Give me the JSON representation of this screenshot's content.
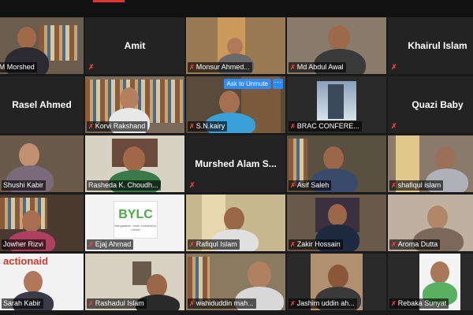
{
  "participants": [
    {
      "name": "AM Morshed",
      "type": "video"
    },
    {
      "name": "Amit",
      "type": "name"
    },
    {
      "name": "Monsur Ahmed...",
      "type": "video"
    },
    {
      "name": "Md Abdul Awal",
      "type": "video"
    },
    {
      "name": "Khairul Islam",
      "type": "name"
    },
    {
      "name": "Rasel Ahmed",
      "type": "name"
    },
    {
      "name": "Korvi Rakshand",
      "type": "video"
    },
    {
      "name": "S.N.kairy",
      "type": "video"
    },
    {
      "name": "BRAC CONFERE...",
      "type": "video"
    },
    {
      "name": "Quazi Baby",
      "type": "name"
    },
    {
      "name": "Shushi Kabir",
      "type": "video"
    },
    {
      "name": "Rasheda K. Choudh...",
      "type": "video",
      "active": true
    },
    {
      "name": "Murshed Alam S...",
      "type": "name"
    },
    {
      "name": "Asif Saleh",
      "type": "video"
    },
    {
      "name": "shafiqul islam",
      "type": "video"
    },
    {
      "name": "Jowher Rizvi",
      "type": "video"
    },
    {
      "name": "Ejaj Ahmad",
      "type": "video"
    },
    {
      "name": "Rafiqul Islam",
      "type": "video"
    },
    {
      "name": "Zakir Hossain",
      "type": "video"
    },
    {
      "name": "Aroma Dutta",
      "type": "video"
    },
    {
      "name": "Sarah Kabir",
      "type": "video"
    },
    {
      "name": "Rashadul Islam",
      "type": "video"
    },
    {
      "name": "wahiduddin mah...",
      "type": "video"
    },
    {
      "name": "Jashim uddin ah...",
      "type": "video"
    },
    {
      "name": "Rebaka Sunyat",
      "type": "video"
    }
  ],
  "overlay": {
    "unmute_label": "Ask to Unmute",
    "more_label": "···"
  },
  "logos": {
    "bylc_title": "BYLC",
    "bylc_subtitle": "Bangladesh Youth Leadership Center",
    "actionaid": "actionaid"
  },
  "colors": {
    "muted_mic": "#e0453a",
    "active_speaker": "#b9d66a",
    "unmute_button": "#2d8cff"
  }
}
